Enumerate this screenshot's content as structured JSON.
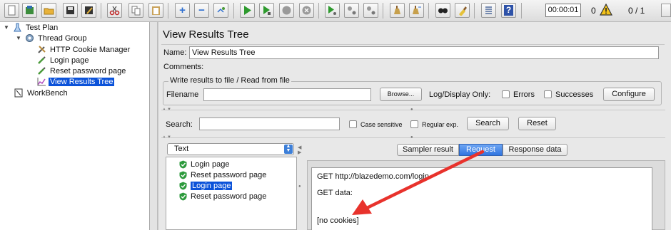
{
  "toolbar": {
    "timer": "00:00:01",
    "error_count": "0",
    "active_threads": "0 / 1",
    "icons": [
      "new-icon",
      "templates-icon",
      "open-icon",
      "save-icon",
      "save-as-icon",
      "cut-icon",
      "copy-icon",
      "paste-icon",
      "expand-icon",
      "collapse-icon",
      "toggle-icon",
      "start-icon",
      "start-no-pause-icon",
      "stop-icon",
      "shutdown-icon",
      "remote-start-icon",
      "remote-stop-icon",
      "remote-shutdown-icon",
      "clear-icon",
      "clear-all-icon",
      "search-icon",
      "reset-search-icon",
      "function-helper-icon",
      "help-icon",
      "warning-icon"
    ]
  },
  "tree": {
    "test_plan": "Test Plan",
    "thread_group": "Thread Group",
    "cookie_manager": "HTTP Cookie Manager",
    "login_page": "Login page",
    "reset_password_page": "Reset password page",
    "view_results_tree": "View Results Tree",
    "workbench": "WorkBench"
  },
  "panel": {
    "title": "View Results Tree",
    "name_label": "Name:",
    "name_value": "View Results Tree",
    "comments_label": "Comments:",
    "file_legend": "Write results to file / Read from file",
    "filename_label": "Filename",
    "browse_label": "Browse...",
    "log_only_label": "Log/Display Only:",
    "errors_label": "Errors",
    "successes_label": "Successes",
    "configure_label": "Configure"
  },
  "search": {
    "label": "Search:",
    "case_sensitive_label": "Case sensitive",
    "regex_label": "Regular exp.",
    "search_button": "Search",
    "reset_button": "Reset"
  },
  "results": {
    "renderer": "Text",
    "items": [
      "Login page",
      "Reset password page",
      "Login page",
      "Reset password page"
    ],
    "selected_index": 2
  },
  "tabs": {
    "sampler_result": "Sampler result",
    "request": "Request",
    "response_data": "Response data",
    "active": "request"
  },
  "request_text": {
    "line1": "GET http://blazedemo.com/login",
    "line2": "GET data:",
    "line3": "[no cookies]"
  },
  "colors": {
    "selection": "#0b52d9",
    "annotation_arrow": "#e8322c",
    "tab_active": "#2f74e0"
  }
}
